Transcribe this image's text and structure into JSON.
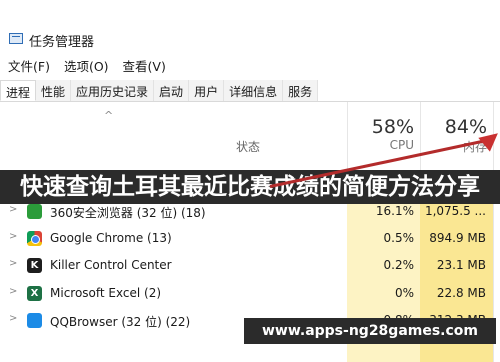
{
  "window": {
    "title": "任务管理器"
  },
  "menu": [
    "文件(F)",
    "选项(O)",
    "查看(V)"
  ],
  "tabs": [
    "进程",
    "性能",
    "应用历史记录",
    "启动",
    "用户",
    "详细信息",
    "服务"
  ],
  "columns": {
    "status_label": "状态",
    "cpu_percent": "58%",
    "cpu_label": "CPU",
    "memory_percent": "84%",
    "memory_label": "内存"
  },
  "overlay_title": "快速查询土耳其最近比赛成绩的简便方法分享",
  "processes": [
    {
      "name": "360安全浏览器 (32 位) (18)",
      "cpu": "16.1%",
      "memory": "1,075.5 ...",
      "icon": "360-browser-icon"
    },
    {
      "name": "Google Chrome (13)",
      "cpu": "0.5%",
      "memory": "894.9 MB",
      "icon": "chrome-icon"
    },
    {
      "name": "Killer Control Center",
      "cpu": "0.2%",
      "memory": "23.1 MB",
      "icon": "killer-icon"
    },
    {
      "name": "Microsoft Excel (2)",
      "cpu": "0%",
      "memory": "22.8 MB",
      "icon": "excel-icon"
    },
    {
      "name": "QQBrowser (32 位) (22)",
      "cpu": "0.8%",
      "memory": "312.3 MB",
      "icon": "qq-browser-icon"
    }
  ],
  "watermark": "www.apps-ng28games.com",
  "colors": {
    "banner_bg": "#2b2b2b",
    "arrow": "#c93131",
    "cpu_heat": "#fdf3c4",
    "mem_heat": "#fae793"
  }
}
